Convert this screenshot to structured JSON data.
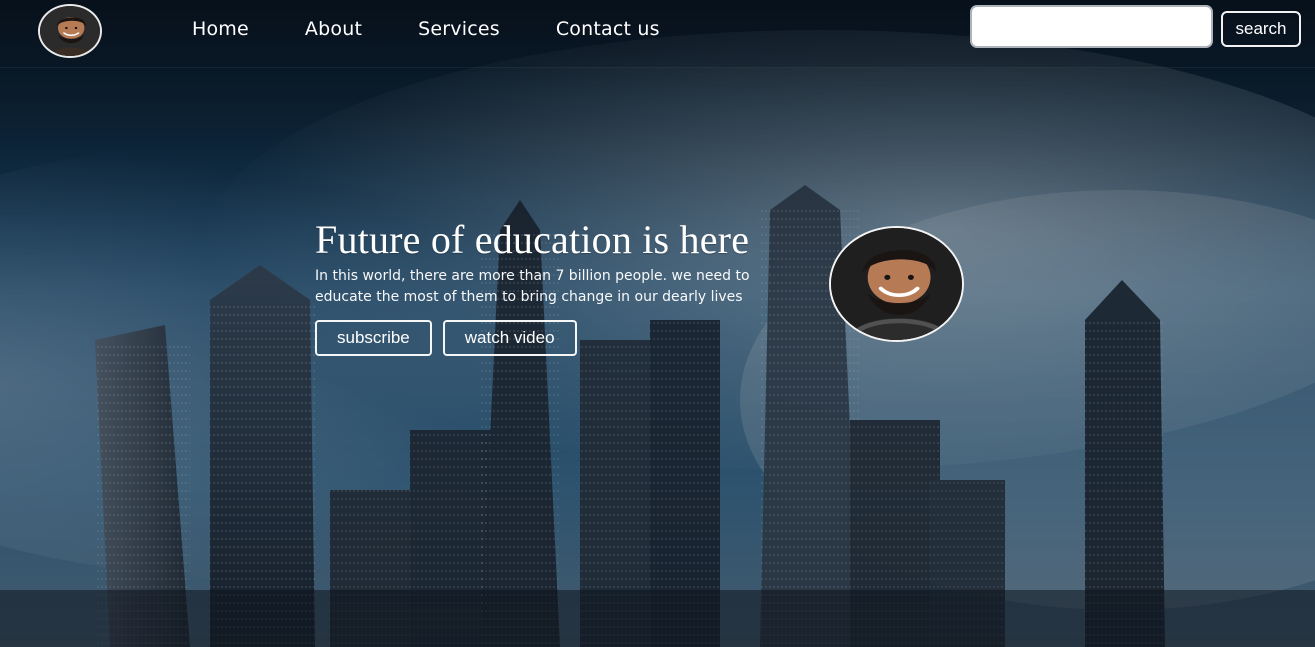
{
  "nav": {
    "items": [
      {
        "label": "Home"
      },
      {
        "label": "About"
      },
      {
        "label": "Services"
      },
      {
        "label": "Contact us"
      }
    ]
  },
  "search": {
    "value": "",
    "placeholder": "",
    "button_label": "search"
  },
  "hero": {
    "title": "Future of education is here",
    "description": "In this world, there are more than 7 billion people. we need to educate the most of them to bring change in our dearly lives",
    "buttons": [
      {
        "label": "subscribe"
      },
      {
        "label": "watch video"
      }
    ]
  },
  "icons": {
    "logo": "profile-avatar-icon",
    "hero_avatar": "profile-avatar-icon"
  },
  "colors": {
    "text": "#ffffff",
    "outline": "#ffffff",
    "search_border": "#a0a5af"
  }
}
